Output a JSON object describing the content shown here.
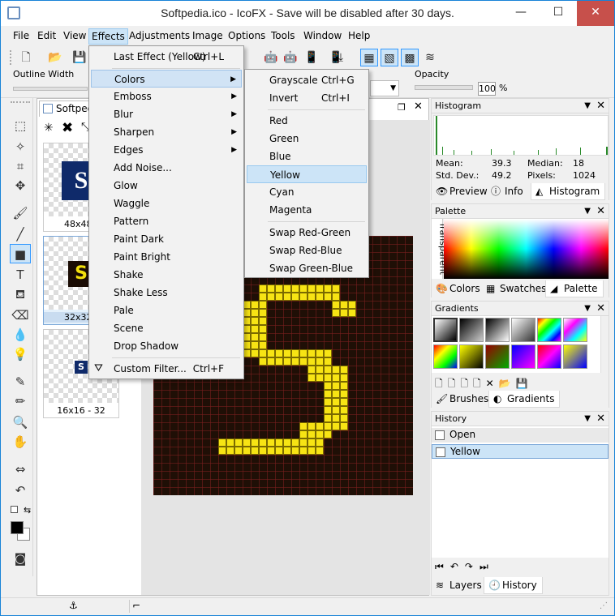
{
  "window": {
    "title": "Softpedia.ico - IcoFX - Save will be disabled after 30 days.",
    "minimize": "—",
    "maximize": "☐",
    "close": "✕"
  },
  "menubar": {
    "items": [
      "File",
      "Edit",
      "View",
      "Effects",
      "Adjustments",
      "Image",
      "Options",
      "Tools",
      "Window",
      "Help"
    ]
  },
  "options_bar": {
    "outline_width_label": "Outline Width",
    "opacity_label": "Opacity",
    "opacity_value": "100",
    "opacity_unit": "%"
  },
  "document": {
    "tab_label": "Softpedia",
    "thumbnails": [
      {
        "label": "48x48 -"
      },
      {
        "label": "32x32 -"
      },
      {
        "label": "16x16 - 32"
      }
    ]
  },
  "effects_menu": {
    "items": [
      {
        "label": "Last Effect (Yellow)",
        "shortcut": "Ctrl+L"
      },
      {
        "label": "Colors",
        "submenu": "▶"
      },
      {
        "label": "Emboss",
        "submenu": "▶"
      },
      {
        "label": "Blur",
        "submenu": "▶"
      },
      {
        "label": "Sharpen",
        "submenu": "▶"
      },
      {
        "label": "Edges",
        "submenu": "▶"
      },
      {
        "label": "Add Noise..."
      },
      {
        "label": "Glow"
      },
      {
        "label": "Waggle"
      },
      {
        "label": "Pattern"
      },
      {
        "label": "Paint Dark"
      },
      {
        "label": "Paint Bright"
      },
      {
        "label": "Shake"
      },
      {
        "label": "Shake Less"
      },
      {
        "label": "Pale"
      },
      {
        "label": "Scene"
      },
      {
        "label": "Drop Shadow"
      },
      {
        "label": "Custom Filter...",
        "shortcut": "Ctrl+F"
      }
    ]
  },
  "colors_submenu": {
    "items": [
      {
        "label": "Grayscale",
        "shortcut": "Ctrl+G"
      },
      {
        "label": "Invert",
        "shortcut": "Ctrl+I"
      },
      {
        "label": "Red"
      },
      {
        "label": "Green"
      },
      {
        "label": "Blue"
      },
      {
        "label": "Yellow"
      },
      {
        "label": "Cyan"
      },
      {
        "label": "Magenta"
      },
      {
        "label": "Swap Red-Green"
      },
      {
        "label": "Swap Red-Blue"
      },
      {
        "label": "Swap Green-Blue"
      }
    ]
  },
  "histogram": {
    "title": "Histogram",
    "mean_label": "Mean:",
    "mean_value": "39.3",
    "median_label": "Median:",
    "median_value": "18",
    "stddev_label": "Std. Dev.:",
    "stddev_value": "49.2",
    "pixels_label": "Pixels:",
    "pixels_value": "1024",
    "tabs": [
      "Preview",
      "Info",
      "Histogram"
    ]
  },
  "palette": {
    "title": "Palette",
    "transparent_label": "Transparent",
    "tabs": [
      "Colors",
      "Swatches",
      "Palette"
    ]
  },
  "gradients": {
    "title": "Gradients",
    "tabs": [
      "Brushes",
      "Gradients"
    ]
  },
  "history": {
    "title": "History",
    "items": [
      "Open",
      "Yellow"
    ],
    "tabs": [
      "Layers",
      "History"
    ]
  }
}
